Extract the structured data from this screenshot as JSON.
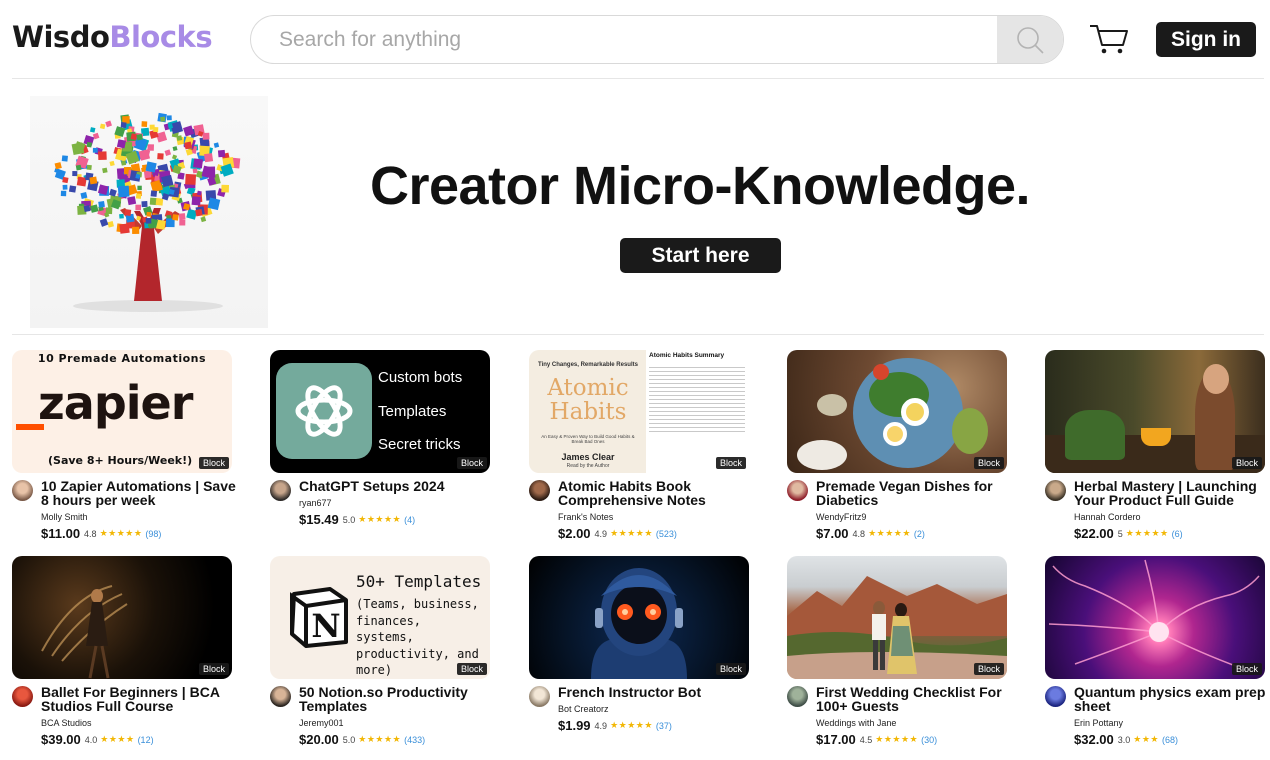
{
  "header": {
    "logo_part1": "Wisdo",
    "logo_part2": "Blocks",
    "search_placeholder": "Search for anything",
    "signin_label": "Sign in"
  },
  "hero": {
    "title": "Creator Micro-Knowledge.",
    "cta_label": "Start here"
  },
  "products": [
    {
      "title": "10 Zapier Automations | Save 8 hours per week",
      "author": "Molly Smith",
      "price": "$11.00",
      "rating": "4.8",
      "stars": "★★★★★",
      "count": "(98)",
      "badge": "Block",
      "thumb_text": {
        "top": "10 Premade Automations",
        "brand": "_zapier",
        "bottom": "(Save 8+ Hours/Week!)"
      }
    },
    {
      "title": "ChatGPT Setups 2024",
      "author": "ryan677",
      "price": "$15.49",
      "rating": "5.0",
      "stars": "★★★★★",
      "count": "(4)",
      "badge": "Block",
      "thumb_text": {
        "line1": "Custom bots",
        "line2": "Templates",
        "line3": "Secret tricks"
      }
    },
    {
      "title": "Atomic Habits Book Comprehensive Notes",
      "author": "Frank's Notes",
      "price": "$2.00",
      "rating": "4.9",
      "stars": "★★★★★",
      "count": "(523)",
      "badge": "Block",
      "thumb_text": {
        "cover_tag": "Tiny Changes, Remarkable Results",
        "cover_title": "Atomic Habits",
        "cover_sub": "An Easy & Proven Way to Build Good Habits & Break Bad Ones",
        "cover_author": "James Clear",
        "cover_read": "Read by the Author",
        "summary_title": "Atomic Habits Summary"
      }
    },
    {
      "title": "Premade Vegan Dishes for Diabetics",
      "author": "WendyFritz9",
      "price": "$7.00",
      "rating": "4.8",
      "stars": "★★★★★",
      "count": "(2)",
      "badge": "Block"
    },
    {
      "title": "Herbal Mastery | Launching Your Product Full Guide",
      "author": "Hannah Cordero",
      "price": "$22.00",
      "rating": "5",
      "stars": "★★★★★",
      "count": "(6)",
      "badge": "Block"
    },
    {
      "title": "Ballet For Beginners | BCA Studios Full Course",
      "author": "BCA Studios",
      "price": "$39.00",
      "rating": "4.0",
      "stars": "★★★★",
      "count": "(12)",
      "badge": "Block"
    },
    {
      "title": "50 Notion.so Productivity Templates",
      "author": "Jeremy001",
      "price": "$20.00",
      "rating": "5.0",
      "stars": "★★★★★",
      "count": "(433)",
      "badge": "Block",
      "thumb_text": {
        "heading": "50+ Templates",
        "body": "(Teams, business, finances, systems, productivity, and more)"
      }
    },
    {
      "title": "French Instructor Bot",
      "author": "Bot Creatorz",
      "price": "$1.99",
      "rating": "4.9",
      "stars": "★★★★★",
      "count": "(37)",
      "badge": "Block"
    },
    {
      "title": "First Wedding Checklist For 100+ Guests",
      "author": "Weddings with Jane",
      "price": "$17.00",
      "rating": "4.5",
      "stars": "★★★★★",
      "count": "(30)",
      "badge": "Block"
    },
    {
      "title": "Quantum physics exam prep sheet",
      "author": "Erin Pottany",
      "price": "$32.00",
      "rating": "3.0",
      "stars": "★★★",
      "count": "(68)",
      "badge": "Block"
    }
  ],
  "colors": {
    "brand_dark": "#1a1a1a",
    "brand_accent": "#a88be6",
    "star": "#f2b705",
    "count_link": "#3a8fd9"
  }
}
